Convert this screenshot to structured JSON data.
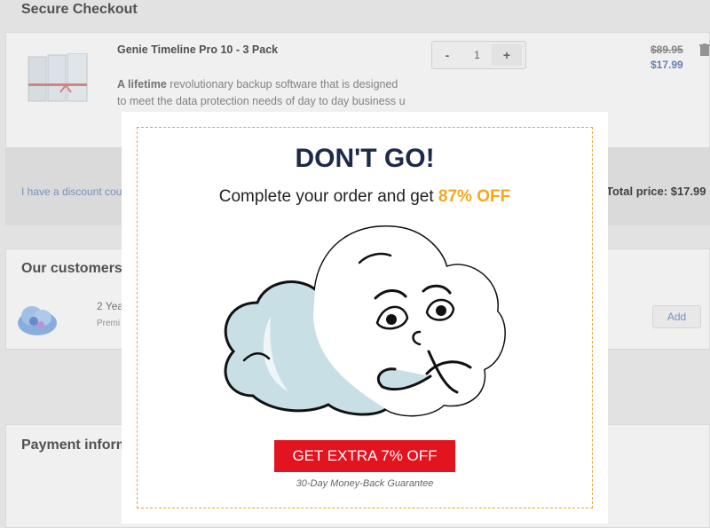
{
  "header": {
    "title": "Secure Checkout"
  },
  "cart": {
    "product_name": "Genie Timeline Pro 10 - 3 Pack",
    "desc_bold": "A lifetime",
    "desc_rest": " revolutionary backup software that is designed to meet the data protection needs of day to day business u",
    "qty_minus": "-",
    "qty_value": "1",
    "qty_plus": "+",
    "old_price": "$89.95",
    "new_price": "$17.99",
    "coupon_link": "I have a discount coup",
    "total_price": "Total price: $17.99"
  },
  "customers": {
    "title": "Our customers",
    "line1": "2 Yea",
    "line2": "Premi",
    "add_label": "Add"
  },
  "payment": {
    "title": "Payment inform"
  },
  "modal": {
    "title": "DON'T GO!",
    "subtitle_prefix": "Complete your order and get ",
    "subtitle_accent": "87% OFF",
    "cta_label": "GET EXTRA 7% OFF",
    "guarantee": "30-Day Money-Back Guarantee",
    "colors": {
      "accent": "#f2a81d",
      "cta_bg": "#e1141f",
      "border": "#e5a53a",
      "title": "#1d2a4a"
    }
  }
}
